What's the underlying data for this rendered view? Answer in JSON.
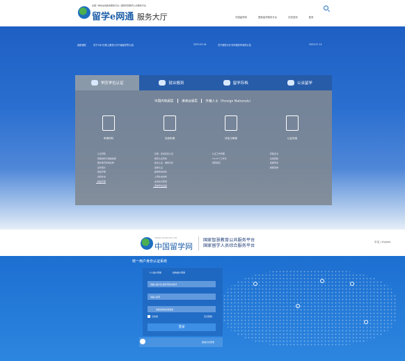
{
  "header": {
    "top_slogan": "全国一体化在线政务服务平台 | 国家智慧教育公共服务平台",
    "brand_title": "留学e网通",
    "brand_sub": "服务大厅",
    "nav": [
      "中国留学网",
      "国家留学服务平台",
      "在线咨询",
      "登录"
    ]
  },
  "ticker": {
    "label": "最新通知",
    "item1": "关于5月4日网上服务大厅升级维护的公告",
    "date1": "2023-03-04",
    "item2": "关于服务大厅对外服务时间的公告",
    "date2": "2023-07-14"
  },
  "tabs": [
    {
      "label": "学历学位认证",
      "icon": "mortarboard-icon",
      "active": true
    },
    {
      "label": "就业报到",
      "icon": "badge-icon",
      "active": false
    },
    {
      "label": "留学存档",
      "icon": "archive-icon",
      "active": false
    },
    {
      "label": "公派留学",
      "icon": "plane-icon",
      "active": false
    }
  ],
  "roles": {
    "r1": "中国内地居民",
    "r2": "港澳台居民",
    "r3": "外籍人士（Foreign Nationals）"
  },
  "steps": [
    {
      "label": "申请材料",
      "icon": "documents-icon"
    },
    {
      "label": "在线申请",
      "icon": "edit-form-icon"
    },
    {
      "label": "评估与审核",
      "icon": "review-eye-icon"
    },
    {
      "label": "认证完成",
      "icon": "certificate-icon"
    }
  ],
  "columns": [
    [
      "· 认证须知",
      "· 所需材料与准备指南",
      "· 国外教育机构名单",
      "· 证件照片",
      "· 授权声明",
      "· 资料补充",
      "· 新版声明"
    ],
    [
      "· 注册、完成实名认证",
      "· 填写认证申请",
      "· 提交认证、缴费付款",
      "· 选择认证",
      "· 邮寄申请材料",
      "· 上传补充材料",
      "· 在线支付费用",
      "· 查看申请进度"
    ],
    [
      "· 认证工作周期",
      "· 19-20个工作日",
      "· 调查核实"
    ],
    [
      "· 获取证书",
      "· 在线查验",
      "· 发票申请",
      "· 邮寄安排"
    ]
  ],
  "footer_brand": {
    "domain": "WWW.CSCSE.EDU.CN",
    "cn_name": "中国留学网",
    "platform1": "国家智慧教育公共服务平台",
    "platform2": "国家留学人员综合服务平台",
    "lang": "中文 | English"
  },
  "login": {
    "title": "统一用户身份认证系统",
    "tab_personal": "个人用户登录",
    "tab_org": "机构用户登录",
    "username_placeholder": "请输入用户名/证件号码/手机号",
    "password_placeholder": "请输入密码",
    "captcha_placeholder": "请拖动滑块完成验证",
    "remember": "记住我",
    "forgot": "忘记密码",
    "submit": "登录",
    "qq_text": "其他方式登录"
  }
}
